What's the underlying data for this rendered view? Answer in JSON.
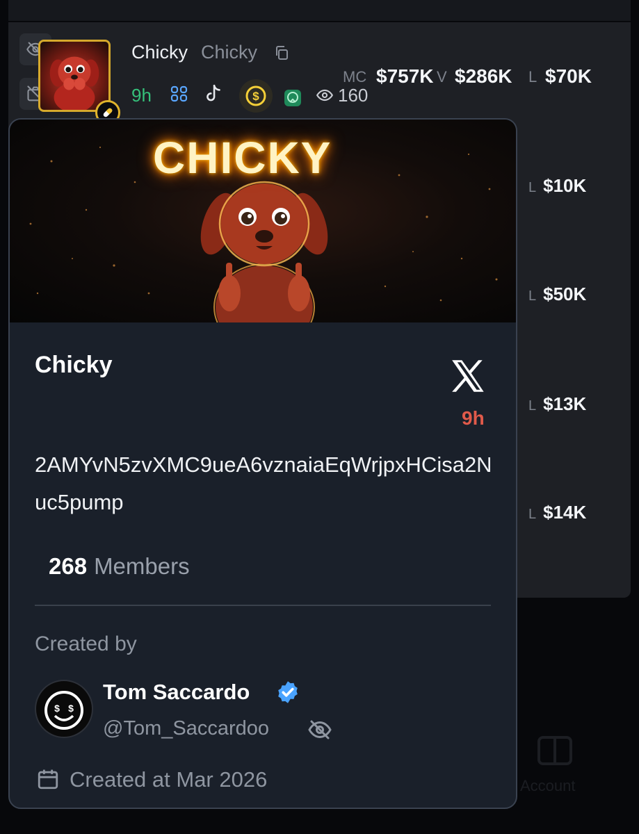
{
  "token": {
    "name": "Chicky",
    "symbol": "Chicky",
    "age": "9h",
    "views": "160",
    "stats": {
      "mc_label": "MC",
      "mc_value": "$757K",
      "v_label": "V",
      "v_value": "$286K",
      "l_label": "L",
      "l_value": "$70K"
    },
    "icons": [
      "eye-slash-icon",
      "camera-slash-icon",
      "people-icon",
      "tiktok-icon",
      "coin-icon",
      "green-badge-icon",
      "eye-icon",
      "copy-icon",
      "pill-icon"
    ]
  },
  "list_rows": [
    {
      "l_label": "L",
      "l_value": "$10K"
    },
    {
      "l_label": "L",
      "l_value": "$50K"
    },
    {
      "l_label": "L",
      "l_value": "$13K"
    },
    {
      "l_label": "L",
      "l_value": "$14K"
    }
  ],
  "popup": {
    "banner_text": "CHICKY",
    "title": "Chicky",
    "age": "9h",
    "address": "2AMYvN5zvXMC9ueA6vznaiaEqWrjpxHCisa2Nuc5pump",
    "members_count": "268",
    "members_label": "Members",
    "created_by_label": "Created by",
    "creator_name": "Tom Saccardo",
    "creator_handle": "@Tom_Saccardoo",
    "created_at": "Created at Mar 2026"
  },
  "nav": {
    "account_label": "Account"
  },
  "colors": {
    "accent_green": "#35c07a",
    "age_red": "#e05a4a",
    "gold": "#d6a92c",
    "verified_blue": "#4aa3ff"
  }
}
